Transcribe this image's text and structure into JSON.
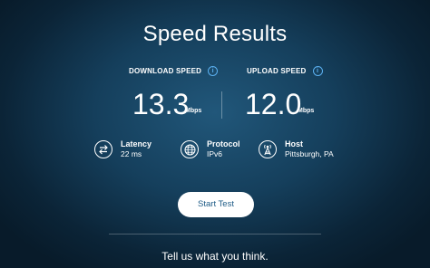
{
  "title": "Speed Results",
  "download": {
    "label": "DOWNLOAD SPEED",
    "value": "13.3",
    "unit": "Mbps",
    "info_icon": "info-icon"
  },
  "upload": {
    "label": "UPLOAD SPEED",
    "value": "12.0",
    "unit": "Mbps",
    "info_icon": "info-icon"
  },
  "details": {
    "latency": {
      "label": "Latency",
      "value": "22 ms",
      "icon": "swap-arrows-icon"
    },
    "protocol": {
      "label": "Protocol",
      "value": "IPv6",
      "icon": "globe-icon"
    },
    "host": {
      "label": "Host",
      "value": "Pittsburgh, PA",
      "icon": "antenna-tower-icon"
    }
  },
  "start_button": "Start Test",
  "feedback_link": "Tell us what you think.",
  "colors": {
    "background": "#153f5c",
    "accent": "#5bb0f0",
    "button_text": "#1d5b86"
  }
}
